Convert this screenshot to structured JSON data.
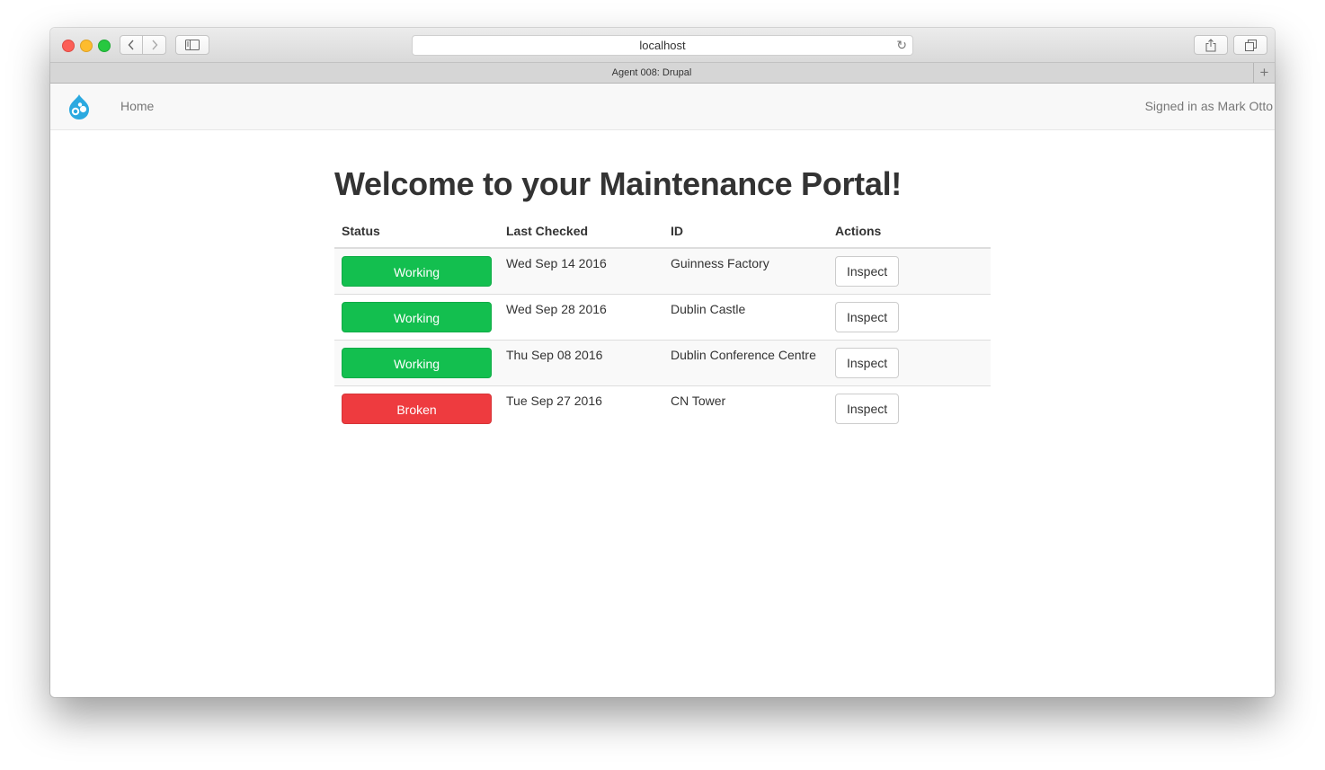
{
  "browser": {
    "address": "localhost",
    "tab_title": "Agent 008: Drupal",
    "controls": {
      "back_icon": "chevron-left-icon",
      "forward_icon": "chevron-right-icon",
      "sidebar_icon": "sidebar-icon",
      "reload_icon": "reload-icon",
      "share_icon": "share-icon",
      "tabs_icon": "tabs-overview-icon",
      "new_tab_icon": "plus-icon"
    }
  },
  "navbar": {
    "logo_icon": "drupal-drop-icon",
    "logo_color": "#2ba9e0",
    "home_label": "Home",
    "signed_in_text": "Signed in as Mark Otto"
  },
  "main": {
    "title": "Welcome to your Maintenance Portal!",
    "table": {
      "headers": [
        "Status",
        "Last Checked",
        "ID",
        "Actions"
      ],
      "rows": [
        {
          "status": "Working",
          "status_color": "#13bf4f",
          "last_checked": "Wed Sep 14 2016",
          "id": "Guinness Factory",
          "action": "Inspect"
        },
        {
          "status": "Working",
          "status_color": "#13bf4f",
          "last_checked": "Wed Sep 28 2016",
          "id": "Dublin Castle",
          "action": "Inspect"
        },
        {
          "status": "Working",
          "status_color": "#13bf4f",
          "last_checked": "Thu Sep 08 2016",
          "id": "Dublin Conference Centre",
          "action": "Inspect"
        },
        {
          "status": "Broken",
          "status_color": "#ee3b3f",
          "last_checked": "Tue Sep 27 2016",
          "id": "CN Tower",
          "action": "Inspect"
        }
      ]
    }
  }
}
